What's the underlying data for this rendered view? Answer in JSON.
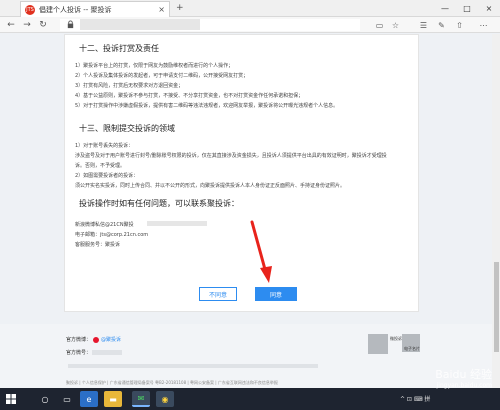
{
  "browser": {
    "tab_title": "倡建个人投诉 -- 聚投诉",
    "tab_favicon_text": "JTS",
    "new_tab": "+",
    "close": "×",
    "window_controls": [
      "—",
      "□",
      "×"
    ]
  },
  "content": {
    "section12_title": "十二、投诉打赏及责任",
    "section12_items": [
      "1）聚投诉平台上的打赏，仅限于网友为鼓励维权者而进行的个人操作；",
      "2）个人投诉及集体投诉的发起者，可于申请支付二维码，公开接受网友打赏；",
      "3）打赏有风险，打赏后无权要求对方退回资金；",
      "4）基于公益原则，聚投诉不参与打赏，不接受、不分享打赏资金，也不对打赏资金作任何承诺和担保；",
      "5）对于打赏操作中涉嫌虚假投诉，提供有害二维码等违法违规者，欢迎网友举报，聚投诉将公开曝光违规者个人信息。"
    ],
    "section13_title": "十三、限制提交投诉的领域",
    "section13_items": [
      "1）对于账号丢失的投诉：",
      "涉及盗号及对于用户账号进行封号/删除账号权限的投诉，仅在其直接涉及资金损失，且投诉人须提供平台出具的有效证明时，聚投诉才受理投",
      "诉。否则，不予受理。",
      "2）如图需要投诉者的投诉：",
      "须公开实名实投诉，同时上传合同、并以不公开的形式，向聚投诉提供投诉人本人身份证正反面照片、手持证身份证照片。"
    ],
    "contact_title": "投诉操作时如有任何问题，可以联系聚投诉：",
    "contact_weibo": "新浪微博私信@21CN聚投",
    "contact_email": "电子邮箱：jts@corp.21cn.com",
    "contact_phone": "客服服务号：聚投诉"
  },
  "buttons": {
    "disagree": "不同意",
    "agree": "同意"
  },
  "footer": {
    "weibo_label": "官方微博：",
    "weibo_link": "@聚投诉",
    "wechat_label": "官方微号：",
    "qr1_label": "微投诉",
    "qr2_label": "电子名片",
    "copyright": "聚投诉 | 个人信息保护 | 广东省通信管理局备案号 粤B2-20181108 | 粤网公安备案 | 广东省互联网违法和不良信息举报"
  },
  "taskbar": {
    "tray_text": "^  ⊡  ⌨  拼"
  },
  "watermark": {
    "line1": "Baidu 经验",
    "line2": "jingyan.baidu.com"
  },
  "colors": {
    "accent": "#2d8cf0",
    "arrow": "#e8231b",
    "brand_red": "#e0301e"
  }
}
